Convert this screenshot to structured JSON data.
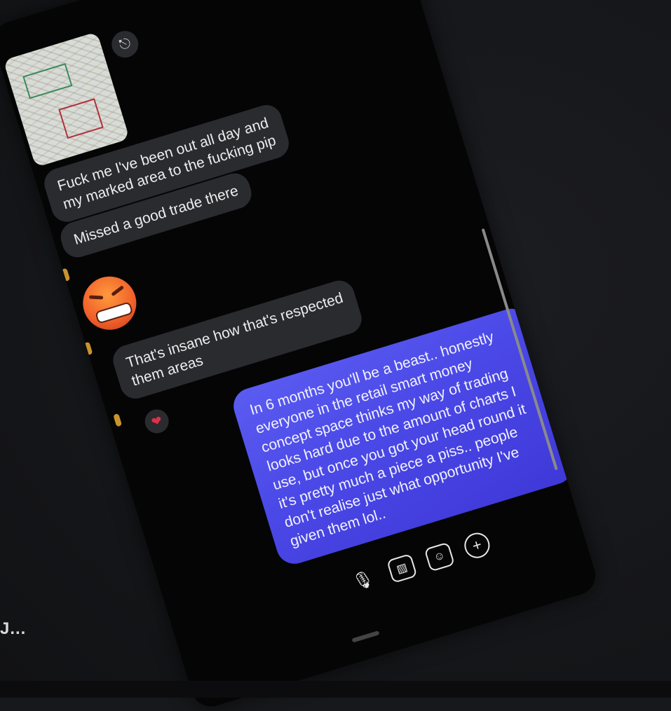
{
  "side_caption": "J...",
  "thread": {
    "attachment_icon": "share-icon",
    "messages_in": [
      {
        "text_lines": [
          "Fuck me I've been out all day and",
          "my marked area to the fucking pip"
        ]
      },
      {
        "text_lines": [
          "Missed a good trade there"
        ]
      },
      {
        "text_lines": [
          "That's insane how that's respected",
          "them areas"
        ]
      }
    ],
    "reaction": {
      "icon": "heart-icon",
      "glyph": "❤"
    },
    "emoji": {
      "name": "angry-face-emoji"
    },
    "message_out": {
      "text": "In 6 months you'll be a beast.. honestly everyone in the retail smart money concept space thinks my way of trading looks hard due to the amount of charts I use, but once you got your head round it it's pretty much a piece a piss.. people don't realise just what opportunity I've given them lol.."
    }
  },
  "composer": {
    "icons": [
      "microphone-icon",
      "image-icon",
      "sticker-icon",
      "add-icon"
    ],
    "glyphs": [
      "🎙",
      "▨",
      "☺",
      "+"
    ]
  },
  "colors": {
    "bubble_in": "#2a2b2f",
    "bubble_out_start": "#5b5cf2",
    "bubble_out_end": "#3f38d8",
    "background": "#050506"
  }
}
